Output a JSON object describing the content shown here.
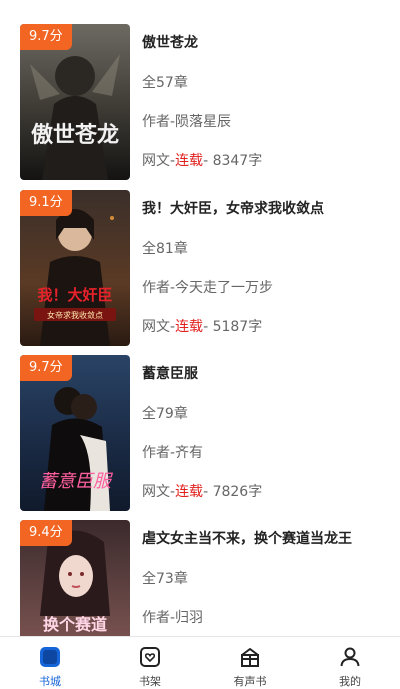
{
  "books": [
    {
      "score": "9.7分",
      "title": "傲世苍龙",
      "chapters": "全57章",
      "author": "作者-陨落星辰",
      "genre": "网文-",
      "status": "连载",
      "words": "- 8347字",
      "cover_text": "傲世苍龙"
    },
    {
      "score": "9.1分",
      "title": "我！大奸臣，女帝求我收敛点",
      "chapters": "全81章",
      "author": "作者-今天走了一万步",
      "genre": "网文-",
      "status": "连载",
      "words": "- 5187字",
      "cover_text": "我！大奸臣",
      "cover_sub": "女帝求我收敛点"
    },
    {
      "score": "9.7分",
      "title": "蓄意臣服",
      "chapters": "全79章",
      "author": "作者-齐有",
      "genre": "网文-",
      "status": "连载",
      "words": "- 7826字",
      "cover_text": "蓄意臣服"
    },
    {
      "score": "9.4分",
      "title": "虐文女主当不来，换个赛道当龙王",
      "chapters": "全73章",
      "author": "作者-归羽",
      "cover_text": "换个赛道"
    }
  ],
  "tabs": [
    {
      "label": "书城",
      "icon": "bookstore-icon",
      "active": true
    },
    {
      "label": "书架",
      "icon": "bookshelf-icon",
      "active": false
    },
    {
      "label": "有声书",
      "icon": "audiobook-icon",
      "active": false
    },
    {
      "label": "我的",
      "icon": "profile-icon",
      "active": false
    }
  ],
  "colors": {
    "score_badge": "#f26522",
    "serial_status": "#e0221f",
    "active_tab": "#1565d8"
  }
}
